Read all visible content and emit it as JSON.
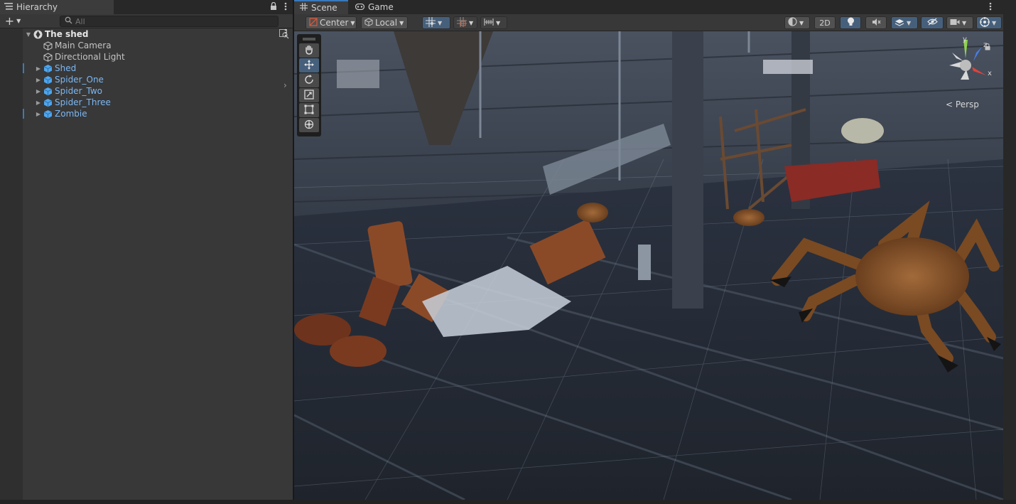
{
  "hierarchy": {
    "tab_title": "Hierarchy",
    "add_label": "+",
    "search_placeholder": "All",
    "root": "The shed",
    "items": [
      {
        "label": "Main Camera",
        "kind": "obj"
      },
      {
        "label": "Directional Light",
        "kind": "obj"
      },
      {
        "label": "Shed",
        "kind": "prefab"
      },
      {
        "label": "Spider_One",
        "kind": "prefab"
      },
      {
        "label": "Spider_Two",
        "kind": "prefab"
      },
      {
        "label": "Spider_Three",
        "kind": "prefab"
      },
      {
        "label": "Zombie",
        "kind": "prefab"
      }
    ]
  },
  "scene": {
    "tabs": {
      "scene": "Scene",
      "game": "Game"
    },
    "toolbar": {
      "pivot": "Center",
      "space": "Local",
      "mode_2d": "2D"
    },
    "tools": [
      "hand-icon",
      "move-icon",
      "rotate-icon",
      "scale-icon",
      "rect-icon",
      "transform-icon"
    ],
    "gizmo": {
      "projection": "Persp",
      "axis_y": "y",
      "axis_x": "x",
      "axis_z": "z"
    }
  },
  "colors": {
    "accent": "#3a79bb",
    "prefab_text": "#7cb7f4",
    "panel_bg": "#383838",
    "gizmo_y": "#8fd14f",
    "gizmo_x": "#e0433a",
    "gizmo_z": "#4a7de8"
  }
}
